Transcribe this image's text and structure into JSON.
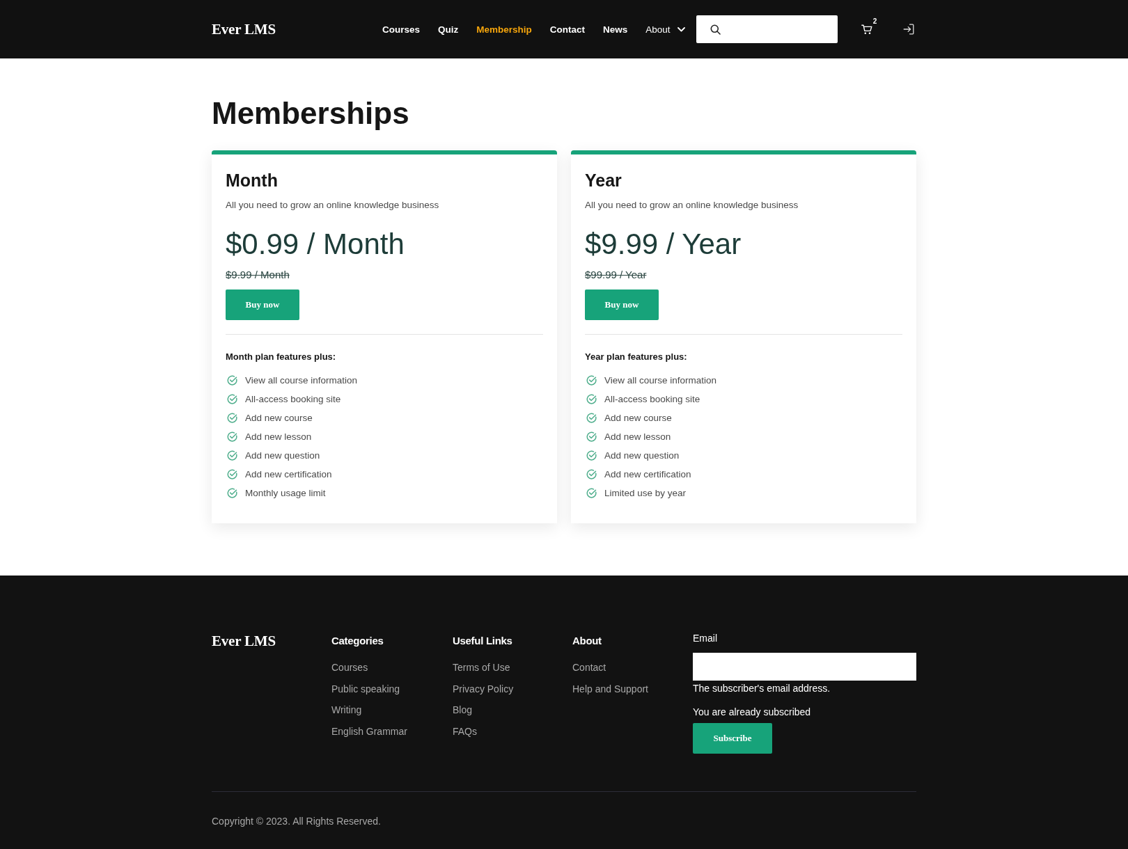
{
  "header": {
    "logo": "Ever LMS",
    "nav": [
      {
        "label": "Courses",
        "kind": "link",
        "selected": false
      },
      {
        "label": "Quiz",
        "kind": "link",
        "selected": false
      },
      {
        "label": "Membership",
        "kind": "link",
        "selected": true
      },
      {
        "label": "Contact",
        "kind": "link",
        "selected": false
      },
      {
        "label": "News",
        "kind": "link",
        "selected": false
      },
      {
        "label": "About",
        "kind": "dropdown",
        "selected": false
      }
    ],
    "cart_count": "2"
  },
  "page_title": "Memberships",
  "plans": [
    {
      "name": "Month",
      "description": "All you need to grow an online knowledge business",
      "price": "$0.99 / Month",
      "original_price": "$9.99 / Month",
      "button": "Buy now",
      "features_title": "Month plan features plus:",
      "features": [
        "View all course information",
        "All-access booking site",
        "Add new course",
        "Add new lesson",
        "Add new question",
        "Add new certification",
        "Monthly usage limit"
      ]
    },
    {
      "name": "Year",
      "description": "All you need to grow an online knowledge business",
      "price": "$9.99 / Year",
      "original_price": "$99.99 / Year",
      "button": "Buy now",
      "features_title": "Year plan features plus:",
      "features": [
        "View all course information",
        "All-access booking site",
        "Add new course",
        "Add new lesson",
        "Add new question",
        "Add new certification",
        "Limited use by year"
      ]
    }
  ],
  "footer": {
    "logo": "Ever LMS",
    "columns": [
      {
        "title": "Categories",
        "links": [
          "Courses",
          "Public speaking",
          "Writing",
          "English Grammar"
        ]
      },
      {
        "title": "Useful Links",
        "links": [
          "Terms of Use",
          "Privacy Policy",
          "Blog",
          "FAQs"
        ]
      },
      {
        "title": "About",
        "links": [
          "Contact",
          "Help and Support"
        ]
      }
    ],
    "newsletter": {
      "label": "Email",
      "helper": "The subscriber's email address.",
      "status": "You are already subscribed",
      "button": "Subscribe"
    },
    "copyright": "Copyright © 2023. All Rights Reserved."
  }
}
